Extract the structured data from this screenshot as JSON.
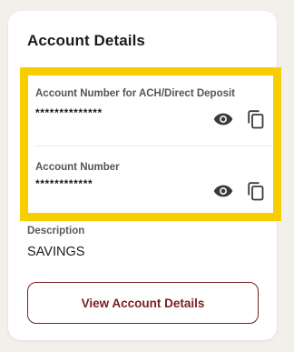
{
  "card": {
    "title": "Account Details"
  },
  "accounts": [
    {
      "label": "Account Number for ACH/Direct Deposit",
      "masked_value": "**************",
      "reveal_icon": "eye-icon",
      "copy_icon": "copy-icon"
    },
    {
      "label": "Account Number",
      "masked_value": "************",
      "reveal_icon": "eye-icon",
      "copy_icon": "copy-icon"
    }
  ],
  "description": {
    "label": "Description",
    "value": "SAVINGS"
  },
  "view_button": {
    "label": "View Account Details"
  },
  "colors": {
    "page_background": "#f3f0ec",
    "card_background": "#ffffff",
    "highlight_border": "#f7cf00",
    "brand_maroon": "#7a1f24",
    "text_dark": "#1b1b1b",
    "text_muted": "#555555"
  }
}
